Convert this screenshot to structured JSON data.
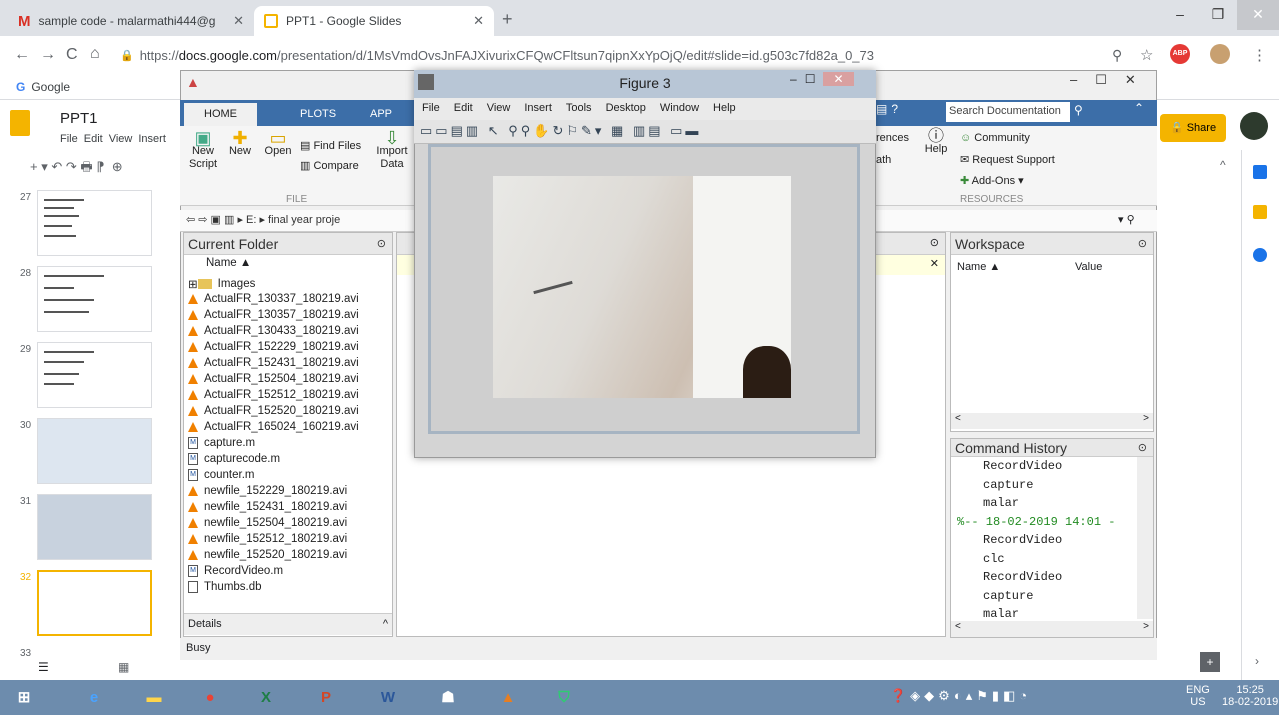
{
  "browser": {
    "tabs": [
      {
        "label": "sample code - malarmathi444@g"
      },
      {
        "label": "PPT1 - Google Slides"
      }
    ],
    "new_tab": "+",
    "url_host": "docs.google.com",
    "url_rest": "/presentation/d/1MsVmdOvsJnFAJXivurixCFQwCFltsun7qipnXxYpOjQ/edit#slide=id.g503c7fd82a_0_73",
    "bookmark": "Google"
  },
  "slides": {
    "title": "PPT1",
    "menu": [
      "File",
      "Edit",
      "View",
      "Insert"
    ],
    "share": "Share",
    "thumb_numbers": [
      "27",
      "28",
      "29",
      "30",
      "31",
      "32",
      "33"
    ]
  },
  "matlab": {
    "tabs": [
      "HOME",
      "PLOTS",
      "APP"
    ],
    "buttons": {
      "new_script": "New Script",
      "new": "New",
      "open": "Open",
      "find_files": "Find Files",
      "compare": "Compare",
      "import_data": "Import Data",
      "preferences": "rences",
      "path": "ath",
      "help": "Help",
      "community": "Community",
      "request_support": "Request Support",
      "addons": "Add-Ons"
    },
    "sections": {
      "file": "FILE",
      "resources": "RESOURCES"
    },
    "search_placeholder": "Search Documentation",
    "path": "E: ▸ final year proje",
    "current_folder": "Current Folder",
    "name_col": "Name ▲",
    "files": [
      {
        "name": "Images",
        "type": "folder"
      },
      {
        "name": "ActualFR_130337_180219.avi",
        "type": "avi"
      },
      {
        "name": "ActualFR_130357_180219.avi",
        "type": "avi"
      },
      {
        "name": "ActualFR_130433_180219.avi",
        "type": "avi"
      },
      {
        "name": "ActualFR_152229_180219.avi",
        "type": "avi"
      },
      {
        "name": "ActualFR_152431_180219.avi",
        "type": "avi"
      },
      {
        "name": "ActualFR_152504_180219.avi",
        "type": "avi"
      },
      {
        "name": "ActualFR_152512_180219.avi",
        "type": "avi"
      },
      {
        "name": "ActualFR_152520_180219.avi",
        "type": "avi"
      },
      {
        "name": "ActualFR_165024_160219.avi",
        "type": "avi"
      },
      {
        "name": "capture.m",
        "type": "m"
      },
      {
        "name": "capturecode.m",
        "type": "m"
      },
      {
        "name": "counter.m",
        "type": "m"
      },
      {
        "name": "newfile_152229_180219.avi",
        "type": "avi"
      },
      {
        "name": "newfile_152431_180219.avi",
        "type": "avi"
      },
      {
        "name": "newfile_152504_180219.avi",
        "type": "avi"
      },
      {
        "name": "newfile_152512_180219.avi",
        "type": "avi"
      },
      {
        "name": "newfile_152520_180219.avi",
        "type": "avi"
      },
      {
        "name": "RecordVideo.m",
        "type": "m"
      },
      {
        "name": "Thumbs.db",
        "type": "db"
      }
    ],
    "details": "Details",
    "status": "Busy",
    "workspace": {
      "title": "Workspace",
      "name_col": "Name ▲",
      "value_col": "Value"
    },
    "history": {
      "title": "Command History",
      "lines": [
        "RecordVideo",
        "capture",
        "malar",
        "%-- 18-02-2019 14:01 -",
        "RecordVideo",
        "clc",
        "RecordVideo",
        "capture",
        "malar"
      ]
    }
  },
  "figure": {
    "title": "Figure 3",
    "menu": [
      "File",
      "Edit",
      "View",
      "Insert",
      "Tools",
      "Desktop",
      "Window",
      "Help"
    ]
  },
  "taskbar": {
    "lang": "ENG",
    "region": "US",
    "time": "15:25",
    "date": "18-02-2019"
  }
}
